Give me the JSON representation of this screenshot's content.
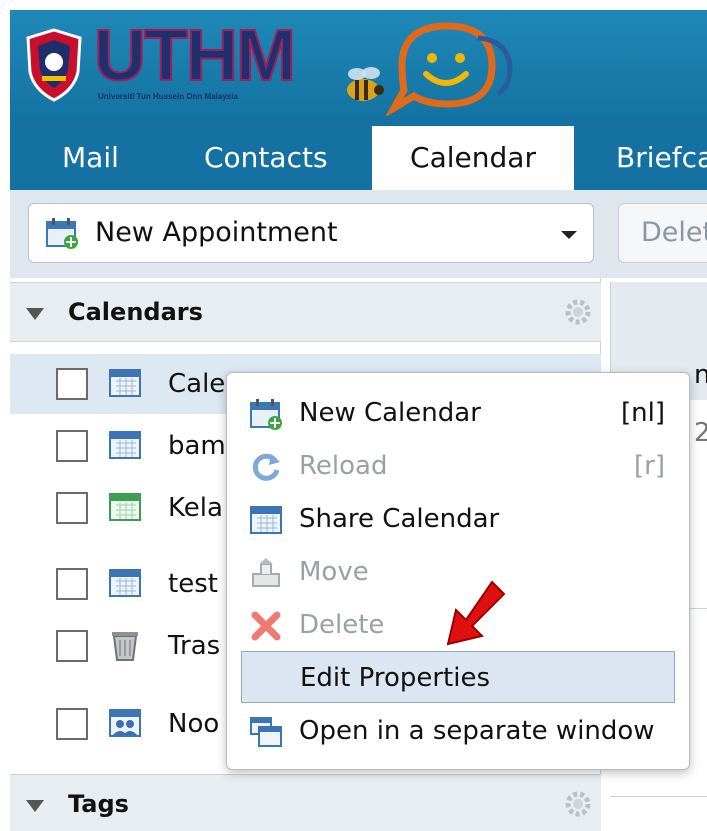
{
  "header": {
    "logo_text": "UTHM",
    "logo_subtitle": "Universiti Tun Hussein Onn Malaysia"
  },
  "tabs": [
    {
      "label": "Mail"
    },
    {
      "label": "Contacts"
    },
    {
      "label": "Calendar"
    },
    {
      "label": "Briefca"
    }
  ],
  "toolbar": {
    "new_appointment": "New Appointment",
    "delete": "Delet"
  },
  "sidebar": {
    "calendars_title": "Calendars",
    "items": [
      {
        "name": "Cale",
        "icon": "calendar-icon"
      },
      {
        "name": "bam",
        "icon": "calendar-icon"
      },
      {
        "name": "Kela",
        "icon": "calendar-green-icon"
      },
      {
        "name": "test",
        "icon": "calendar-icon"
      },
      {
        "name": "Tras",
        "icon": "trash-icon"
      },
      {
        "name": "Noo",
        "icon": "shared-calendar-icon"
      }
    ],
    "tags_title": "Tags"
  },
  "right_pane": {
    "peek1": "nc",
    "peek2": "2"
  },
  "context_menu": {
    "items": [
      {
        "label": "New Calendar",
        "shortcut": "[nl]",
        "icon": "new-calendar-icon",
        "disabled": false
      },
      {
        "label": "Reload",
        "shortcut": "[r]",
        "icon": "reload-icon",
        "disabled": true
      },
      {
        "label": "Share Calendar",
        "shortcut": "",
        "icon": "share-calendar-icon",
        "disabled": false
      },
      {
        "label": "Move",
        "shortcut": "",
        "icon": "move-icon",
        "disabled": true
      },
      {
        "label": "Delete",
        "shortcut": "",
        "icon": "delete-icon",
        "disabled": true
      },
      {
        "label": "Edit Properties",
        "shortcut": "",
        "icon": "",
        "disabled": false
      },
      {
        "label": "Open in a separate window",
        "shortcut": "",
        "icon": "open-window-icon",
        "disabled": false
      }
    ]
  },
  "colors": {
    "header_blue": "#1571a2",
    "selection": "#dde8f3",
    "arrow_red": "#e01010"
  }
}
